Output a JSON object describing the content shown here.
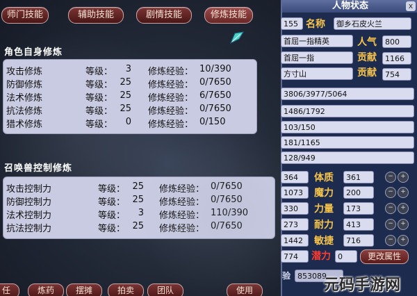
{
  "tabs": [
    "师门技能",
    "辅助技能",
    "剧情技能",
    "修炼技能"
  ],
  "self_section": {
    "title": "角色自身修炼",
    "rows": [
      {
        "name": "攻击修炼",
        "level_label": "等级：",
        "level": "3",
        "exp_label": "修炼经验：",
        "exp": "10/390"
      },
      {
        "name": "防御修炼",
        "level_label": "等级：",
        "level": "25",
        "exp_label": "修炼经验：",
        "exp": "0/7650"
      },
      {
        "name": "法术修炼",
        "level_label": "等级：",
        "level": "25",
        "exp_label": "修炼经验：",
        "exp": "6/7650"
      },
      {
        "name": "抗法修炼",
        "level_label": "等级：",
        "level": "25",
        "exp_label": "修炼经验：",
        "exp": "0/7650"
      },
      {
        "name": "猎术修炼",
        "level_label": "等级：",
        "level": "0",
        "exp_label": "修炼经验：",
        "exp": "0/150"
      }
    ]
  },
  "pet_section": {
    "title": "召唤兽控制修炼",
    "rows": [
      {
        "name": "攻击控制力",
        "level_label": "等级：",
        "level": "25",
        "exp_label": "修炼经验：",
        "exp": "0/7650"
      },
      {
        "name": "防御控制力",
        "level_label": "等级：",
        "level": "25",
        "exp_label": "修炼经验：",
        "exp": "0/7650"
      },
      {
        "name": "法术控制力",
        "level_label": "等级：",
        "level": "3",
        "exp_label": "修炼经验：",
        "exp": "110/390"
      },
      {
        "name": "抗法控制力",
        "level_label": "等级：",
        "level": "25",
        "exp_label": "修炼经验：",
        "exp": "0/7650"
      }
    ]
  },
  "bottom_buttons": [
    "任",
    "炼药",
    "摆摊",
    "拍卖",
    "团队",
    "使用"
  ],
  "status": {
    "title": "人物状态",
    "close": "x",
    "id_partial": "155",
    "name_label": "名称",
    "name_value": "御乡石皮火兰",
    "title_value": "首屈一指精英",
    "popularity_label": "人气",
    "popularity_value": "800",
    "rank_value": "首屈一指",
    "contribution_label": "贡献",
    "contribution_value": "1166",
    "sect_value": "方寸山",
    "contribution2_label": "贡献",
    "contribution2_value": "754",
    "bars": [
      "3806/3977/5064",
      "1486/1792",
      "103/150",
      "181/1165",
      "128/949"
    ],
    "attributes": [
      {
        "left": "364",
        "label": "体质",
        "value": "361"
      },
      {
        "left": "1073",
        "label": "魔力",
        "value": "200"
      },
      {
        "left": "330",
        "label": "力量",
        "value": "173"
      },
      {
        "left": "273",
        "label": "耐力",
        "value": "413"
      },
      {
        "left": "1442",
        "label": "敏捷",
        "value": "716"
      }
    ],
    "potential_left": "774",
    "potential_label": "潜力",
    "potential_value": "0",
    "change_button": "更改属性",
    "bottom_label": "验",
    "bottom_value": "853089"
  },
  "watermark": "元码手游网"
}
